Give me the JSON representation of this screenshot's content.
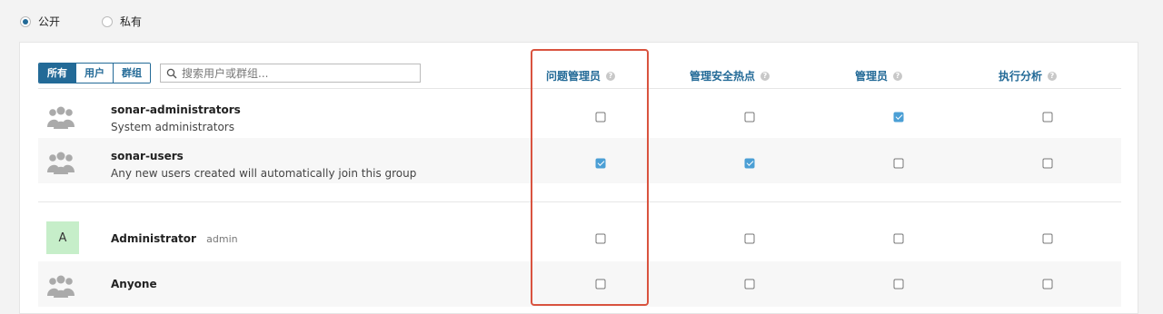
{
  "visibility": {
    "options": [
      {
        "label": "公开",
        "selected": true
      },
      {
        "label": "私有",
        "selected": false
      }
    ]
  },
  "filter": {
    "tabs": [
      "所有",
      "用户",
      "群组"
    ],
    "active_tab": "所有",
    "search_placeholder": "搜索用户或群组..."
  },
  "columns": [
    "问题管理员",
    "管理安全热点",
    "管理员",
    "执行分析"
  ],
  "groups": [
    {
      "name": "sonar-administrators",
      "description": "System administrators",
      "permissions": [
        false,
        false,
        true,
        false
      ]
    },
    {
      "name": "sonar-users",
      "description": "Any new users created will automatically join this group",
      "permissions": [
        true,
        true,
        false,
        false
      ]
    }
  ],
  "users": [
    {
      "avatar_letter": "A",
      "name": "Administrator",
      "login": "admin",
      "permissions": [
        false,
        false,
        false,
        false
      ]
    },
    {
      "name": "Anyone",
      "permissions": [
        false,
        false,
        false,
        false
      ]
    }
  ],
  "colors": {
    "accent": "#236a97",
    "checked": "#4b9fd5",
    "highlight_border": "#d9533f",
    "avatar_bg": "#c6eec9"
  }
}
